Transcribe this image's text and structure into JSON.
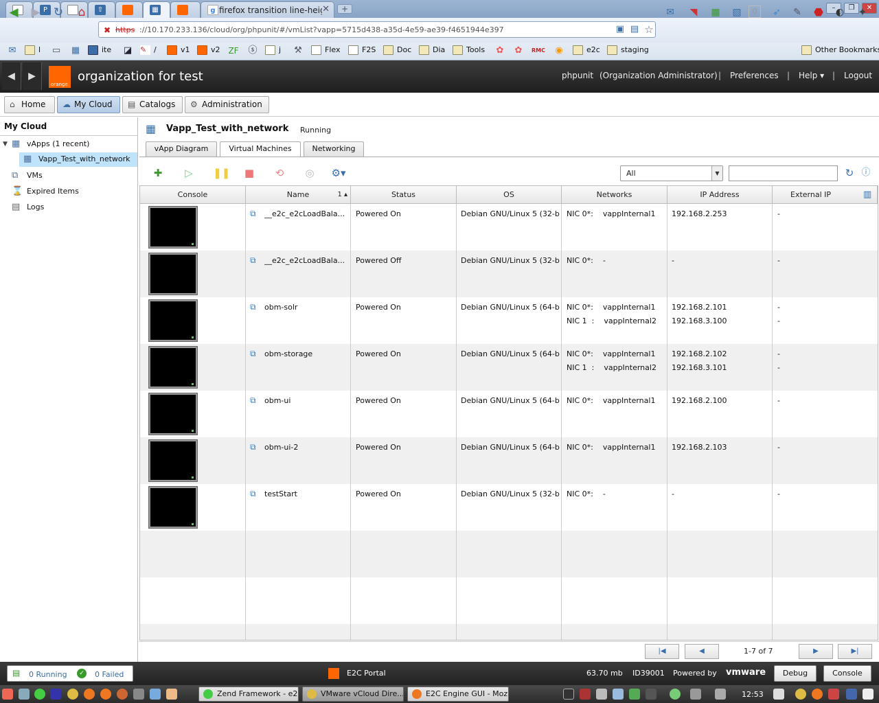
{
  "browser": {
    "tabs": [
      {
        "label": ""
      },
      {
        "label": ""
      },
      {
        "label": ""
      },
      {
        "label": ""
      },
      {
        "label": ""
      },
      {
        "label": ""
      },
      {
        "label": ""
      },
      {
        "label": "firefox transition line-heig"
      }
    ],
    "url_scheme": "https",
    "url_rest": "://10.170.233.136/cloud/org/phpunit/#/vmList?vapp=5715d438-a35d-4e59-ae39-f4651944e397",
    "bookmarks": [
      "l",
      "ite",
      "/",
      "v1",
      "v2",
      "j",
      "Flex",
      "F2S",
      "Doc",
      "Dia",
      "Tools",
      "e2c",
      "staging"
    ],
    "other_bookmarks": "Other Bookmarks"
  },
  "header": {
    "brand": "orange",
    "org_name": "organization for test",
    "user": "phpunit",
    "role": "(Organization Administrator)",
    "preferences": "Preferences",
    "help": "Help ▾",
    "logout": "Logout"
  },
  "mainnav": {
    "home": "Home",
    "mycloud": "My Cloud",
    "catalogs": "Catalogs",
    "administration": "Administration"
  },
  "sidebar": {
    "title": "My Cloud",
    "vapps": "vApps (1 recent)",
    "vapp_selected": "Vapp_Test_with_network",
    "vms": "VMs",
    "expired": "Expired Items",
    "logs": "Logs"
  },
  "content": {
    "vapp_name": "Vapp_Test_with_network",
    "vapp_status": "Running",
    "tabs": {
      "diagram": "vApp Diagram",
      "vms": "Virtual Machines",
      "networking": "Networking"
    },
    "filter_value": "All",
    "search_placeholder": ""
  },
  "grid": {
    "columns": [
      "Console",
      "Name",
      "Status",
      "OS",
      "Networks",
      "IP Address",
      "External IP"
    ],
    "sort_indicator": "1 ▴",
    "rows": [
      {
        "name": "__e2c_e2cLoadBala...",
        "status": "Powered On",
        "os": "Debian GNU/Linux 5 (32-b",
        "nic1": "NIC 0*:    vappInternal1",
        "ip1": "192.168.2.253",
        "ext1": "-",
        "nic2": "",
        "ip2": "",
        "ext2": ""
      },
      {
        "name": "__e2c_e2cLoadBala...",
        "status": "Powered Off",
        "os": "Debian GNU/Linux 5 (32-b",
        "nic1": "NIC 0*:    -",
        "ip1": "-",
        "ext1": "-",
        "nic2": "",
        "ip2": "",
        "ext2": ""
      },
      {
        "name": "obm-solr",
        "status": "Powered On",
        "os": "Debian GNU/Linux 5 (64-b",
        "nic1": "NIC 0*:    vappInternal1",
        "ip1": "192.168.2.101",
        "ext1": "-",
        "nic2": "NIC 1  :    vappInternal2",
        "ip2": "192.168.3.100",
        "ext2": "-"
      },
      {
        "name": "obm-storage",
        "status": "Powered On",
        "os": "Debian GNU/Linux 5 (64-b",
        "nic1": "NIC 0*:    vappInternal1",
        "ip1": "192.168.2.102",
        "ext1": "-",
        "nic2": "NIC 1  :    vappInternal2",
        "ip2": "192.168.3.101",
        "ext2": "-"
      },
      {
        "name": "obm-ui",
        "status": "Powered On",
        "os": "Debian GNU/Linux 5 (64-b",
        "nic1": "NIC 0*:    vappInternal1",
        "ip1": "192.168.2.100",
        "ext1": "-",
        "nic2": "",
        "ip2": "",
        "ext2": ""
      },
      {
        "name": "obm-ui-2",
        "status": "Powered On",
        "os": "Debian GNU/Linux 5 (64-b",
        "nic1": "NIC 0*:    vappInternal1",
        "ip1": "192.168.2.103",
        "ext1": "-",
        "nic2": "",
        "ip2": "",
        "ext2": ""
      },
      {
        "name": "testStart",
        "status": "Powered On",
        "os": "Debian GNU/Linux 5 (32-b",
        "nic1": "NIC 0*:    -",
        "ip1": "-",
        "ext1": "-",
        "nic2": "",
        "ip2": "",
        "ext2": ""
      }
    ]
  },
  "pager": {
    "range": "1-7 of 7"
  },
  "footer": {
    "running": "0 Running",
    "failed": "0 Failed",
    "portal": "E2C Portal",
    "memory": "63.70 mb",
    "id": "ID39001",
    "powered_by": "Powered by",
    "vendor": "vmware",
    "debug": "Debug",
    "console": "Console"
  },
  "taskbar": {
    "tasks": [
      "Zend Framework - e2...",
      "VMware vCloud Dire...",
      "E2C Engine GUI - Moz..."
    ],
    "clock": "12:53"
  },
  "colors": {
    "accent_orange": "#ff6600",
    "selection_blue": "#bfe3fb",
    "link_blue": "#3a6ea8"
  }
}
